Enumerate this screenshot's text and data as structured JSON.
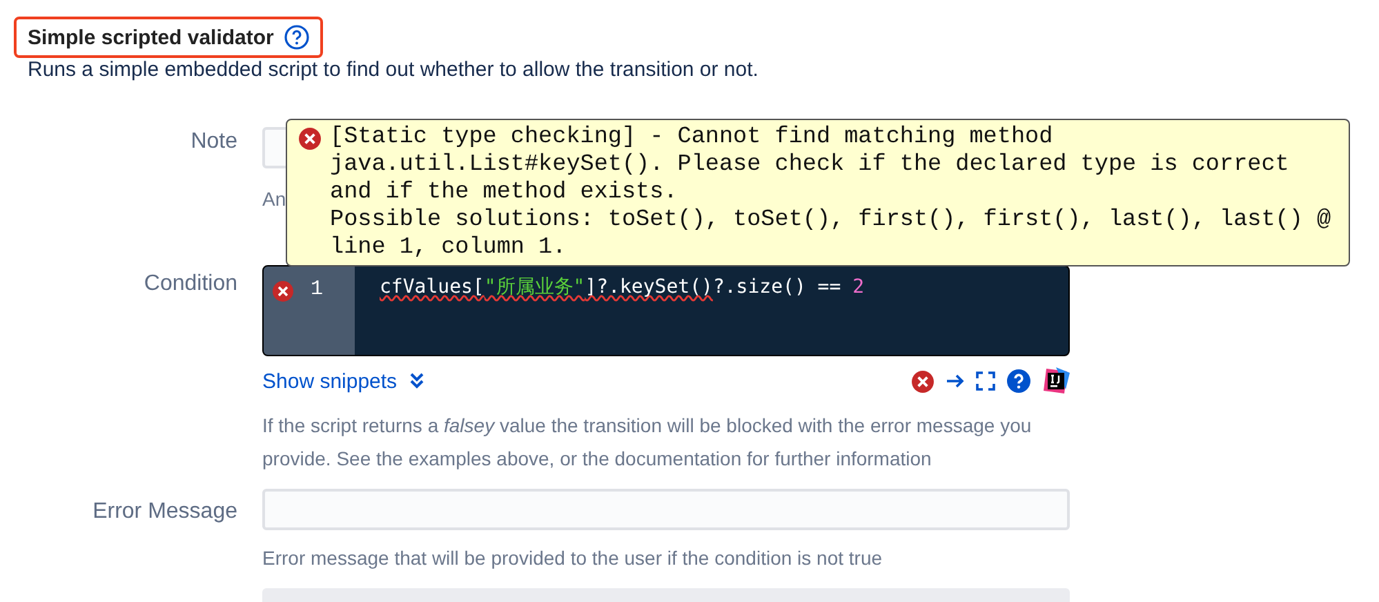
{
  "section": {
    "title": "Simple scripted validator",
    "description": "Runs a simple embedded script to find out whether to allow the transition or not.",
    "highlighted": true
  },
  "note": {
    "label": "Note",
    "hint": "An"
  },
  "tooltip": {
    "message": "[Static type checking] - Cannot find matching method java.util.List#keySet(). Please check if the declared type is correct and if the method exists.\nPossible solutions: toSet(), toSet(), first(), first(), last(), last() @ line 1, column 1."
  },
  "condition": {
    "label": "Condition",
    "line_number": "1",
    "has_error": true,
    "tokens": [
      {
        "kind": "plain",
        "text": "cfValues[",
        "error": true
      },
      {
        "kind": "string",
        "text": "\"所属业务\"",
        "error": true
      },
      {
        "kind": "plain",
        "text": "]?.keySet()",
        "error": true
      },
      {
        "kind": "plain",
        "text": "?.size() == ",
        "error": false
      },
      {
        "kind": "number",
        "text": "2",
        "error": false
      }
    ],
    "snippets_link": "Show snippets",
    "help": "If the script returns a *falsey* value the transition will be blocked with the error message you provide. See the examples above, or the documentation for further information"
  },
  "error_message": {
    "label": "Error Message",
    "hint": "Error message that will be provided to the user if the condition is not true"
  }
}
